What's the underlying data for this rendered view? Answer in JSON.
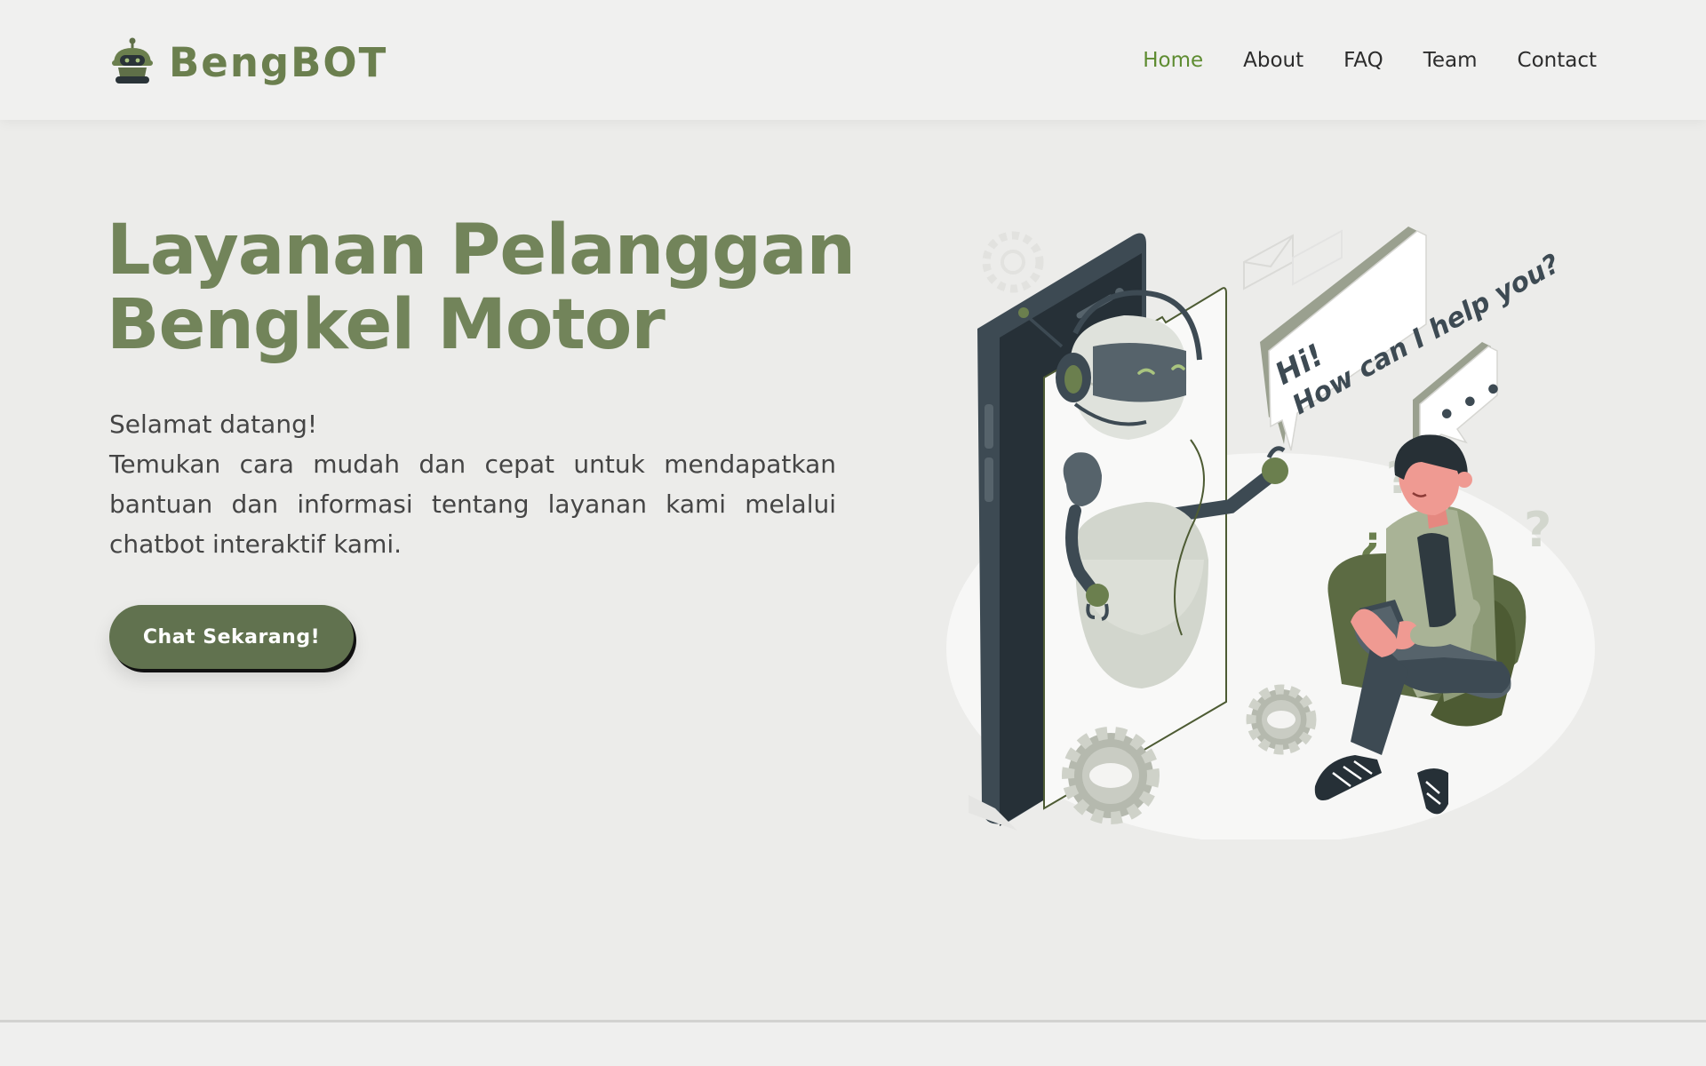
{
  "header": {
    "brand": "BengBOT",
    "nav": [
      {
        "label": "Home",
        "active": true
      },
      {
        "label": "About",
        "active": false
      },
      {
        "label": "FAQ",
        "active": false
      },
      {
        "label": "Team",
        "active": false
      },
      {
        "label": "Contact",
        "active": false
      }
    ]
  },
  "hero": {
    "title_line1": "Layanan Pelanggan",
    "title_line2": "Bengkel Motor",
    "greeting": "Selamat datang!",
    "description": "Temukan cara mudah dan cepat untuk mendapatkan bantuan dan informasi tentang layanan kami melalui chatbot interaktif kami.",
    "cta_label": "Chat Sekarang!"
  },
  "illustration": {
    "speech_bubble_line1": "Hi!",
    "speech_bubble_line2": "How can I help you?",
    "typing_dots": "• • •",
    "question_marks": [
      "?",
      "¿",
      "?"
    ]
  },
  "colors": {
    "brand_green": "#6b7f4e",
    "title_green": "#72845a",
    "nav_active": "#5e8c31",
    "button_bg": "#61724f",
    "page_bg": "#ececea",
    "header_bg": "#f0f0ef"
  },
  "icons": {
    "logo": "robot-logo-icon",
    "illustration": "chatbot-phone-illustration"
  }
}
